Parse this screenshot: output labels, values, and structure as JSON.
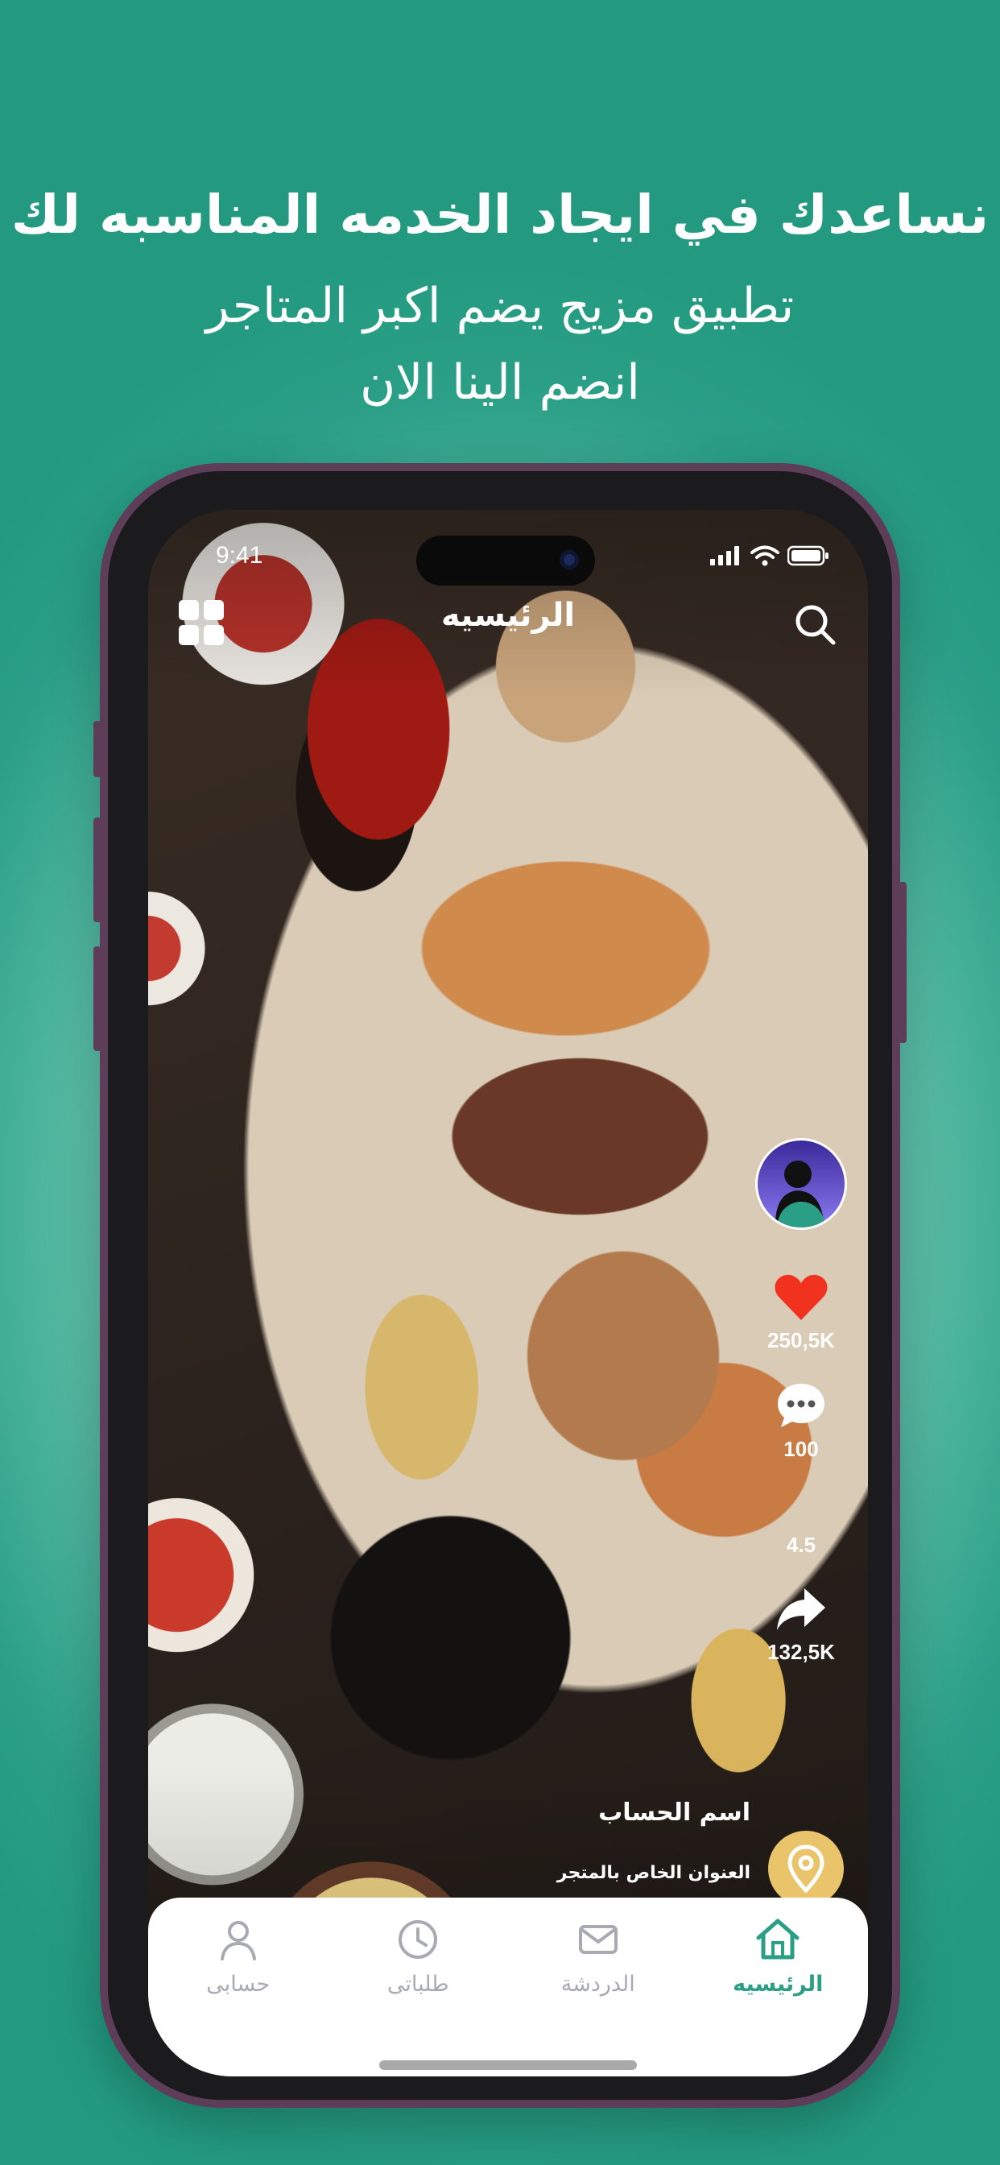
{
  "promo": {
    "title": "نساعدك في ايجاد الخدمه المناسبه لك",
    "subtitle_line1": "تطبيق مزيج يضم اكبر المتاجر",
    "subtitle_line2": "انضم الينا الان"
  },
  "status_bar": {
    "time": "9:41"
  },
  "header": {
    "title": "الرئيسيه"
  },
  "actions": {
    "likes": "250,5K",
    "comments": "100",
    "rating": "4.5",
    "shares": "132,5K"
  },
  "store": {
    "account_name": "اسم الحساب",
    "address": "العنوان الخاص بالمتجر"
  },
  "tabs": [
    {
      "label": "الرئيسيه",
      "icon": "home-icon",
      "active": true
    },
    {
      "label": "الدردشة",
      "icon": "mail-icon",
      "active": false
    },
    {
      "label": "طلباتى",
      "icon": "clock-icon",
      "active": false
    },
    {
      "label": "حسابى",
      "icon": "user-icon",
      "active": false
    }
  ],
  "colors": {
    "brand": "#2a9f86",
    "phone_frame": "#5e3d59",
    "like": "#f0321e",
    "pin": "#e9c46a"
  }
}
